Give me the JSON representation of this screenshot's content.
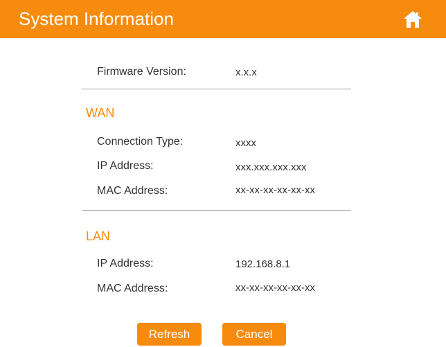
{
  "header": {
    "title": "System Information",
    "home_icon": "home-icon",
    "color": "#f78b0e"
  },
  "firmware": {
    "label": "Firmware Version:",
    "value": "x.x.x"
  },
  "wan": {
    "title": "WAN",
    "connection_type": {
      "label": "Connection Type:",
      "value": "xxxx"
    },
    "ip_address": {
      "label": "IP Address:",
      "value": "xxx.xxx.xxx.xxx"
    },
    "mac_address": {
      "label": "MAC Address:",
      "value": "xx-xx-xx-xx-xx-xx"
    }
  },
  "lan": {
    "title": "LAN",
    "ip_address": {
      "label": "IP Address:",
      "value": "192.168.8.1"
    },
    "mac_address": {
      "label": "MAC Address:",
      "value": "xx-xx-xx-xx-xx-xx"
    }
  },
  "buttons": {
    "refresh": "Refresh",
    "cancel": "Cancel"
  }
}
